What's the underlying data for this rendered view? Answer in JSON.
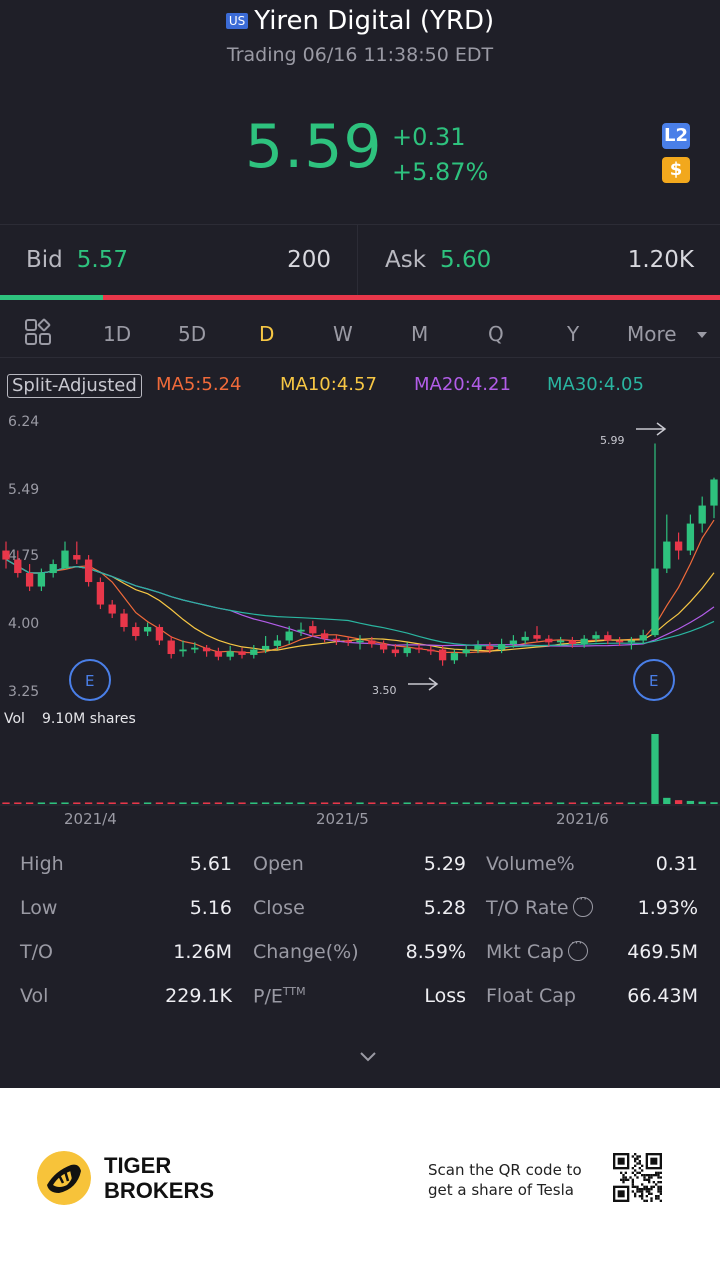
{
  "header": {
    "market_badge": "US",
    "title": "Yiren Digital (YRD)",
    "status_line": "Trading 06/16 11:38:50 EDT",
    "price": "5.59",
    "change": "+0.31",
    "change_pct": "+5.87%",
    "level2_icon": "L2",
    "dollar_icon": "$"
  },
  "quote": {
    "bid_label": "Bid",
    "bid_price": "5.57",
    "bid_size": "200",
    "ask_label": "Ask",
    "ask_price": "5.60",
    "ask_size": "1.20K",
    "bid_ratio": 0.143
  },
  "tabs": {
    "items": [
      "1D",
      "5D",
      "D",
      "W",
      "M",
      "Q",
      "Y",
      "More"
    ],
    "active": "D"
  },
  "indicators": {
    "split": "Split-Adjusted",
    "ma5": "MA5:5.24",
    "ma10": "MA10:4.57",
    "ma20": "MA20:4.21",
    "ma30": "MA30:4.05"
  },
  "chart_data": {
    "type": "candlestick",
    "y_ticks": [
      "6.24",
      "5.49",
      "4.75",
      "4.00",
      "3.25"
    ],
    "ylim": [
      3.25,
      6.24
    ],
    "x_labels": [
      "2021/4",
      "2021/5",
      "2021/6"
    ],
    "high_marker": "5.99",
    "low_marker": "3.50",
    "earnings_marker": "E",
    "volume_label": "Vol",
    "volume_value": "9.10M shares",
    "candles": [
      [
        4.8,
        4.7,
        4.9,
        4.6
      ],
      [
        4.7,
        4.55,
        4.8,
        4.5
      ],
      [
        4.55,
        4.4,
        4.65,
        4.35
      ],
      [
        4.4,
        4.55,
        4.6,
        4.35
      ],
      [
        4.55,
        4.65,
        4.7,
        4.5
      ],
      [
        4.6,
        4.8,
        4.9,
        4.6
      ],
      [
        4.75,
        4.7,
        4.9,
        4.65
      ],
      [
        4.7,
        4.45,
        4.75,
        4.4
      ],
      [
        4.45,
        4.2,
        4.5,
        4.15
      ],
      [
        4.2,
        4.1,
        4.25,
        4.05
      ],
      [
        4.1,
        3.95,
        4.15,
        3.9
      ],
      [
        3.95,
        3.85,
        4.0,
        3.8
      ],
      [
        3.9,
        3.95,
        4.0,
        3.85
      ],
      [
        3.95,
        3.8,
        3.98,
        3.75
      ],
      [
        3.8,
        3.65,
        3.85,
        3.6
      ],
      [
        3.68,
        3.7,
        3.8,
        3.62
      ],
      [
        3.7,
        3.72,
        3.78,
        3.66
      ],
      [
        3.72,
        3.68,
        3.75,
        3.62
      ],
      [
        3.68,
        3.62,
        3.72,
        3.58
      ],
      [
        3.62,
        3.68,
        3.74,
        3.58
      ],
      [
        3.68,
        3.64,
        3.72,
        3.6
      ],
      [
        3.64,
        3.7,
        3.75,
        3.6
      ],
      [
        3.7,
        3.74,
        3.85,
        3.66
      ],
      [
        3.74,
        3.8,
        3.86,
        3.7
      ],
      [
        3.8,
        3.9,
        3.96,
        3.76
      ],
      [
        3.9,
        3.92,
        4.0,
        3.85
      ],
      [
        3.96,
        3.88,
        4.02,
        3.84
      ],
      [
        3.88,
        3.82,
        3.92,
        3.78
      ],
      [
        3.82,
        3.8,
        3.86,
        3.75
      ],
      [
        3.8,
        3.78,
        3.84,
        3.74
      ],
      [
        3.78,
        3.8,
        3.86,
        3.7
      ],
      [
        3.8,
        3.76,
        3.84,
        3.72
      ],
      [
        3.76,
        3.7,
        3.8,
        3.66
      ],
      [
        3.7,
        3.66,
        3.76,
        3.62
      ],
      [
        3.66,
        3.72,
        3.78,
        3.62
      ],
      [
        3.72,
        3.7,
        3.76,
        3.66
      ],
      [
        3.7,
        3.68,
        3.74,
        3.64
      ],
      [
        3.7,
        3.58,
        3.74,
        3.52
      ],
      [
        3.58,
        3.66,
        3.7,
        3.54
      ],
      [
        3.66,
        3.7,
        3.74,
        3.62
      ],
      [
        3.7,
        3.74,
        3.8,
        3.66
      ],
      [
        3.74,
        3.7,
        3.78,
        3.66
      ],
      [
        3.7,
        3.76,
        3.82,
        3.66
      ],
      [
        3.76,
        3.8,
        3.86,
        3.72
      ],
      [
        3.8,
        3.84,
        3.9,
        3.76
      ],
      [
        3.86,
        3.82,
        3.96,
        3.78
      ],
      [
        3.82,
        3.78,
        3.86,
        3.74
      ],
      [
        3.78,
        3.8,
        3.84,
        3.74
      ],
      [
        3.8,
        3.76,
        3.84,
        3.72
      ],
      [
        3.76,
        3.82,
        3.86,
        3.72
      ],
      [
        3.82,
        3.86,
        3.9,
        3.78
      ],
      [
        3.86,
        3.8,
        3.9,
        3.76
      ],
      [
        3.8,
        3.78,
        3.84,
        3.74
      ],
      [
        3.78,
        3.8,
        3.84,
        3.7
      ],
      [
        3.8,
        3.86,
        3.92,
        3.76
      ],
      [
        3.86,
        4.6,
        5.99,
        3.84
      ],
      [
        4.6,
        4.9,
        5.2,
        4.55
      ],
      [
        4.9,
        4.8,
        5.0,
        4.7
      ],
      [
        4.8,
        5.1,
        5.2,
        4.75
      ],
      [
        5.1,
        5.3,
        5.4,
        5.0
      ],
      [
        5.3,
        5.59,
        5.61,
        5.16
      ]
    ],
    "volumes": [
      0.2,
      0.2,
      0.2,
      0.2,
      0.2,
      0.2,
      0.2,
      0.2,
      0.2,
      0.2,
      0.2,
      0.2,
      0.2,
      0.2,
      0.2,
      0.2,
      0.2,
      0.2,
      0.2,
      0.2,
      0.2,
      0.2,
      0.2,
      0.2,
      0.2,
      0.2,
      0.2,
      0.2,
      0.2,
      0.2,
      0.2,
      0.2,
      0.2,
      0.2,
      0.2,
      0.2,
      0.2,
      0.2,
      0.2,
      0.2,
      0.2,
      0.2,
      0.2,
      0.2,
      0.2,
      0.2,
      0.2,
      0.2,
      0.2,
      0.2,
      0.2,
      0.2,
      0.2,
      0.2,
      0.2,
      9.1,
      0.8,
      0.5,
      0.4,
      0.3,
      0.23
    ]
  },
  "stats": {
    "high_label": "High",
    "high": "5.61",
    "open_label": "Open",
    "open": "5.29",
    "volpct_label": "Volume%",
    "volpct": "0.31",
    "low_label": "Low",
    "low": "5.16",
    "close_label": "Close",
    "close": "5.28",
    "torate_label": "T/O Rate",
    "torate": "1.93%",
    "to_label": "T/O",
    "to": "1.26M",
    "changepct_label": "Change(%)",
    "changepct": "8.59%",
    "mktcap_label": "Mkt Cap",
    "mktcap": "469.5M",
    "vol_label": "Vol",
    "vol": "229.1K",
    "pe_label": "P/E",
    "pe_sup": "TTM",
    "pe": "Loss",
    "floatcap_label": "Float Cap",
    "floatcap": "66.43M"
  },
  "footer": {
    "brand_line1": "TIGER",
    "brand_line2": "BROKERS",
    "promo_line1": "Scan the QR code to",
    "promo_line2": "get a share of Tesla"
  },
  "colors": {
    "up": "#2ec27e",
    "down": "#e8374a",
    "ma5": "#f06a3a",
    "ma10": "#f7c744",
    "ma20": "#b25de8",
    "ma30": "#2ab5a0",
    "active_tab": "#f7c744"
  }
}
